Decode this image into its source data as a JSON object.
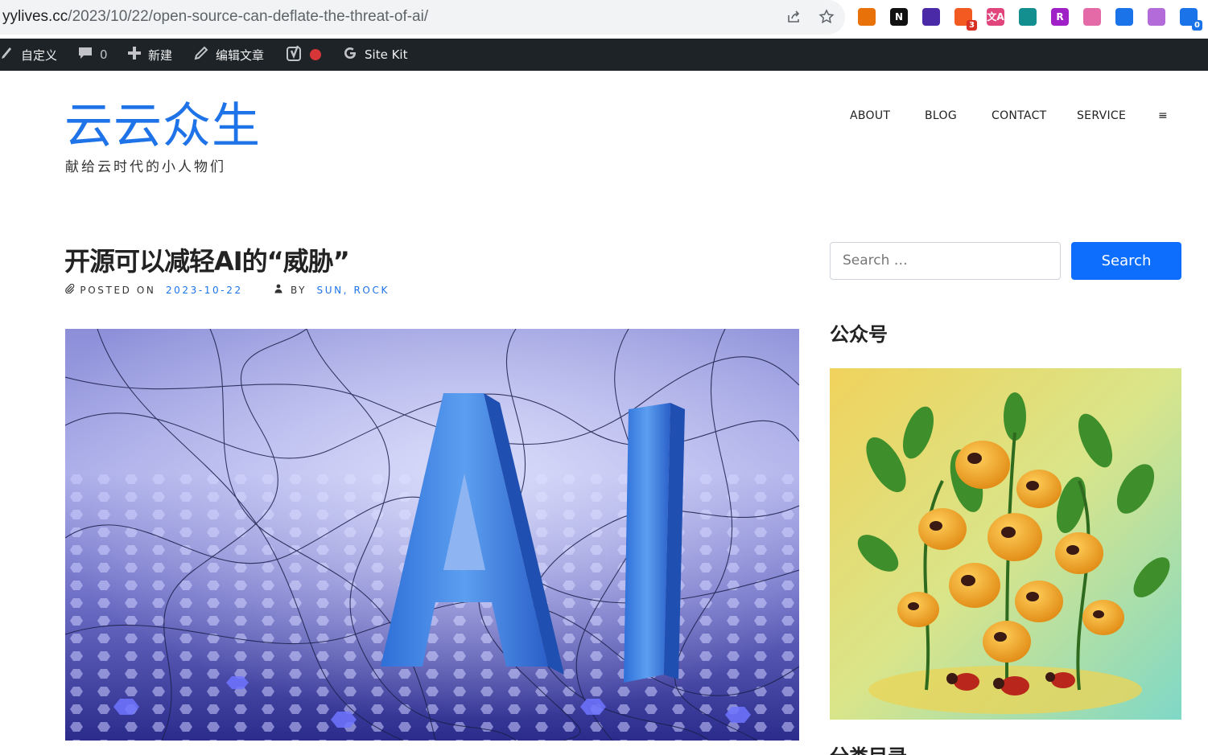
{
  "browser": {
    "url_host": "yylives.cc",
    "url_path": "/2023/10/22/open-source-can-deflate-the-threat-of-ai/",
    "icons": [
      "share-icon",
      "star-icon"
    ],
    "extensions": [
      {
        "name": "extension-chrome-icon",
        "color": "#e8710a"
      },
      {
        "name": "extension-notion-icon",
        "color": "#111111",
        "glyph": "N"
      },
      {
        "name": "extension-layers-icon",
        "color": "#4b2aa8"
      },
      {
        "name": "extension-coins-icon",
        "color": "#f25a22",
        "badge": "3",
        "badge_color": "#d93025"
      },
      {
        "name": "extension-translate-icon",
        "color": "#e0457b",
        "glyph": "文A"
      },
      {
        "name": "extension-teal-icon",
        "color": "#138f8f"
      },
      {
        "name": "extension-purple-icon",
        "color": "#a020c8",
        "glyph": "R"
      },
      {
        "name": "extension-crown-icon",
        "color": "#e46aa7"
      },
      {
        "name": "extension-feather-icon",
        "color": "#1a73e8"
      },
      {
        "name": "extension-openai-icon",
        "color": "#b36bd9"
      },
      {
        "name": "extension-sync-icon",
        "color": "#1a73e8",
        "badge": "0",
        "badge_color": "#1a73e8"
      }
    ]
  },
  "admin_bar": {
    "customize": "自定义",
    "comments_count": "0",
    "new": "新建",
    "edit_post": "编辑文章",
    "site_kit": "Site Kit"
  },
  "site": {
    "title": "云云众生",
    "tagline": "献给云时代的小人物们"
  },
  "nav": {
    "items": [
      "ABOUT",
      "BLOG",
      "CONTACT",
      "SERVICE"
    ],
    "menu_icon": "≡"
  },
  "post": {
    "title": "开源可以减轻AI的“威胁”",
    "posted_on_label": "POSTED ON",
    "date": "2023-10-22",
    "by_label": "BY",
    "author": "SUN, ROCK",
    "image_text": "AI"
  },
  "sidebar": {
    "search_placeholder": "Search …",
    "search_button": "Search",
    "widget_wechat": "公众号",
    "widget_categories": "分类目录"
  },
  "colors": {
    "accent": "#1e73e8",
    "button": "#0d6efd",
    "admin_bar": "#1d2327"
  }
}
